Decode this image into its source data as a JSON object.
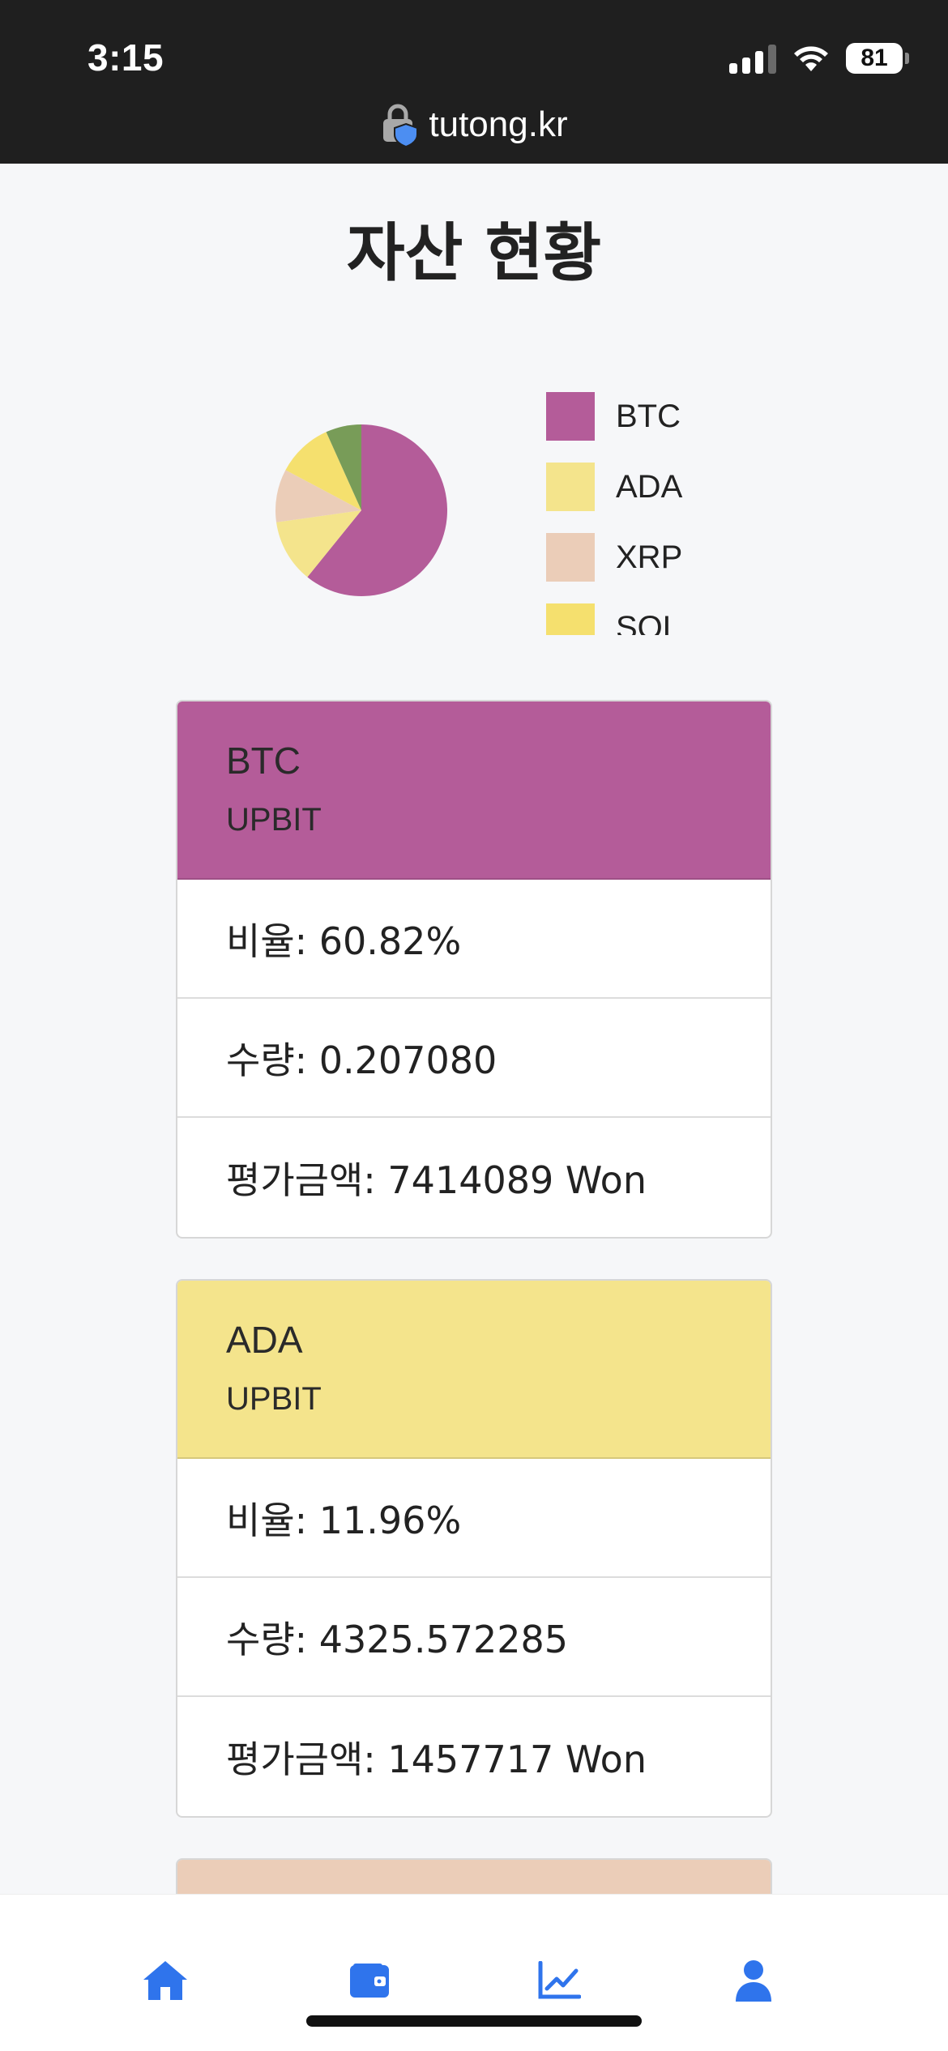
{
  "status_bar": {
    "time": "3:15",
    "battery": "81"
  },
  "browser": {
    "url": "tutong.kr"
  },
  "page": {
    "title": "자산 현황"
  },
  "colors": {
    "btc": "#b45c99",
    "ada": "#f4e48c",
    "xrp": "#ebcdb8",
    "sol": "#f5e06e",
    "other": "#789c58",
    "nav_accent": "#2f74ec"
  },
  "chart_data": {
    "type": "pie",
    "labels": [
      "BTC",
      "ADA",
      "XRP",
      "SOL"
    ],
    "values": [
      60.82,
      11.96,
      10.0,
      10.5,
      6.72
    ],
    "colors": [
      "#b45c99",
      "#f4e48c",
      "#ebcdb8",
      "#f5e06e",
      "#789c58"
    ],
    "legend_position": "right"
  },
  "legend": [
    {
      "label": "BTC"
    },
    {
      "label": "ADA"
    },
    {
      "label": "XRP"
    },
    {
      "label": "SOL"
    }
  ],
  "cards": [
    {
      "symbol": "BTC",
      "exchange": "UPBIT",
      "ratio": "비율: 60.82%",
      "quantity": "수량: 0.207080",
      "value": "평가금액: 7414089 Won"
    },
    {
      "symbol": "ADA",
      "exchange": "UPBIT",
      "ratio": "비율: 11.96%",
      "quantity": "수량: 4325.572285",
      "value": "평가금액: 1457717 Won"
    }
  ],
  "nav": [
    {
      "icon": "home-icon"
    },
    {
      "icon": "wallet-icon"
    },
    {
      "icon": "chart-line-icon"
    },
    {
      "icon": "user-icon"
    }
  ]
}
